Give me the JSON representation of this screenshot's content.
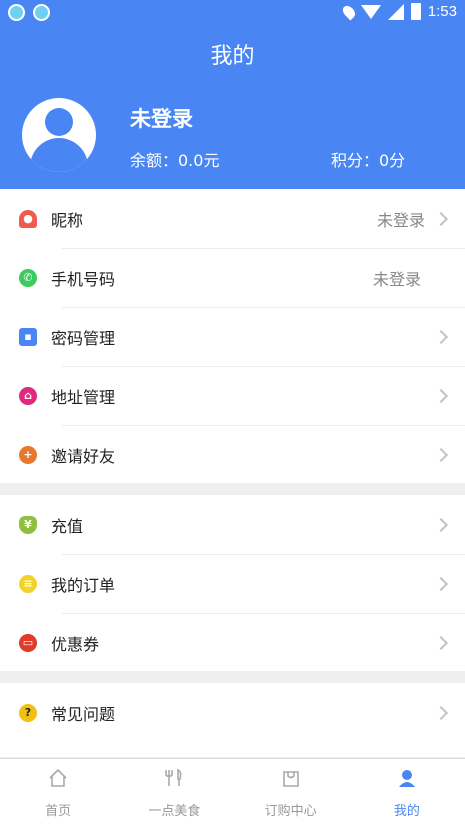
{
  "status_bar": {
    "time": "1:53",
    "battery": "2"
  },
  "header": {
    "title": "我的",
    "username": "未登录",
    "balance": "余额：0.0元",
    "points": "积分：0分"
  },
  "colors": {
    "accent": "#4a86f3"
  },
  "menu_sections": [
    [
      {
        "label": "昵称",
        "value": "未登录",
        "icon": "person-icon",
        "icon_color": "#f05b4f"
      },
      {
        "label": "手机号码",
        "value": "未登录",
        "icon": "phone-icon",
        "icon_color": "#3ccb5f"
      },
      {
        "label": "密码管理",
        "value": "",
        "icon": "lock-icon",
        "icon_color": "#4a86f3"
      },
      {
        "label": "地址管理",
        "value": "",
        "icon": "address-icon",
        "icon_color": "#e0287c"
      },
      {
        "label": "邀请好友",
        "value": "",
        "icon": "invite-icon",
        "icon_color": "#e8772e"
      }
    ],
    [
      {
        "label": "充值",
        "value": "",
        "icon": "recharge-icon",
        "icon_color": "#8fbf3e"
      },
      {
        "label": "我的订单",
        "value": "",
        "icon": "order-icon",
        "icon_color": "#f3d22c"
      },
      {
        "label": "优惠券",
        "value": "",
        "icon": "coupon-icon",
        "icon_color": "#e03a2b"
      }
    ],
    [
      {
        "label": "常见问题",
        "value": "",
        "icon": "help-icon",
        "icon_color": "#f2c014"
      }
    ]
  ],
  "tabs": [
    {
      "label": "首页",
      "icon": "home-icon"
    },
    {
      "label": "一点美食",
      "icon": "food-icon"
    },
    {
      "label": "订购中心",
      "icon": "bag-icon"
    },
    {
      "label": "我的",
      "icon": "profile-icon"
    }
  ]
}
